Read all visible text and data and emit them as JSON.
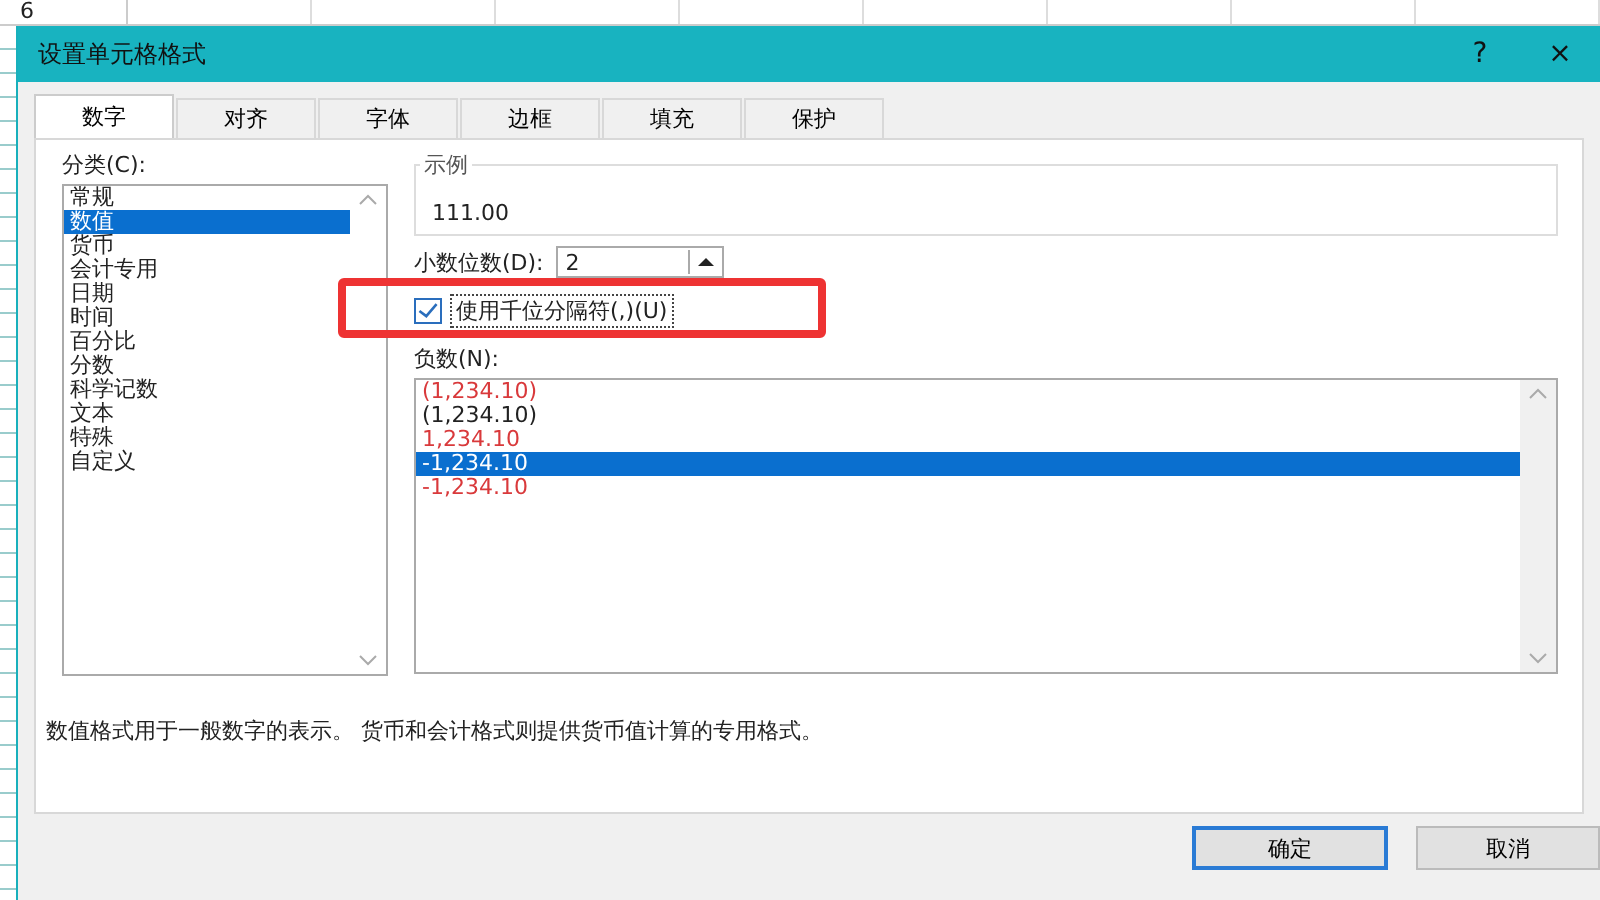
{
  "sheet": {
    "row_label": "6"
  },
  "window": {
    "title": "设置单元格格式",
    "help": "?",
    "close": "×"
  },
  "tabs": [
    {
      "label": "数字",
      "selected": true
    },
    {
      "label": "对齐",
      "selected": false
    },
    {
      "label": "字体",
      "selected": false
    },
    {
      "label": "边框",
      "selected": false
    },
    {
      "label": "填充",
      "selected": false
    },
    {
      "label": "保护",
      "selected": false
    }
  ],
  "category": {
    "label": "分类(C):",
    "items": [
      {
        "label": "常规",
        "selected": false
      },
      {
        "label": "数值",
        "selected": true
      },
      {
        "label": "货币",
        "selected": false
      },
      {
        "label": "会计专用",
        "selected": false
      },
      {
        "label": "日期",
        "selected": false
      },
      {
        "label": "时间",
        "selected": false
      },
      {
        "label": "百分比",
        "selected": false
      },
      {
        "label": "分数",
        "selected": false
      },
      {
        "label": "科学记数",
        "selected": false
      },
      {
        "label": "文本",
        "selected": false
      },
      {
        "label": "特殊",
        "selected": false
      },
      {
        "label": "自定义",
        "selected": false
      }
    ]
  },
  "sample": {
    "label": "示例",
    "value": "111.00"
  },
  "decimal_places": {
    "label": "小数位数(D):",
    "value": "2"
  },
  "thousands_separator": {
    "label": "使用千位分隔符(,)(U)",
    "checked": true,
    "highlighted": true
  },
  "negative_numbers": {
    "label": "负数(N):",
    "items": [
      {
        "label": "(1,234.10)",
        "red": true,
        "selected": false
      },
      {
        "label": "(1,234.10)",
        "red": false,
        "selected": false
      },
      {
        "label": "1,234.10",
        "red": true,
        "selected": false
      },
      {
        "label": "-1,234.10",
        "red": false,
        "selected": true
      },
      {
        "label": "-1,234.10",
        "red": true,
        "selected": false
      }
    ]
  },
  "description": "数值格式用于一般数字的表示。 货币和会计格式则提供货币值计算的专用格式。",
  "buttons": [
    {
      "label": "确定",
      "default": true
    },
    {
      "label": "取消",
      "default": false
    }
  ]
}
